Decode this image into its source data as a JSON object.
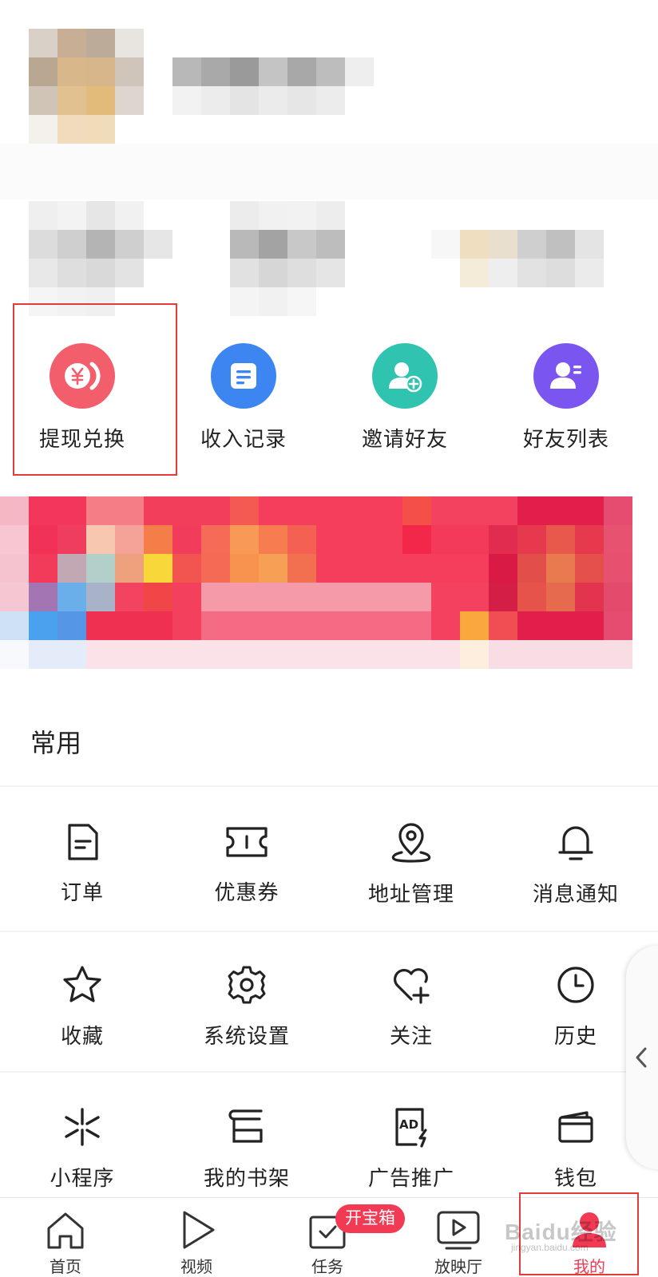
{
  "quick_actions": [
    {
      "label": "提现兑换",
      "icon": "yuan-coin-icon",
      "color": "#f25e6b"
    },
    {
      "label": "收入记录",
      "icon": "document-list-icon",
      "color": "#3d86f2"
    },
    {
      "label": "邀请好友",
      "icon": "add-user-icon",
      "color": "#2fc3b0"
    },
    {
      "label": "好友列表",
      "icon": "user-list-icon",
      "color": "#7a55f0"
    }
  ],
  "common": {
    "title": "常用",
    "items": [
      {
        "label": "订单",
        "icon": "order-icon"
      },
      {
        "label": "优惠券",
        "icon": "coupon-icon"
      },
      {
        "label": "地址管理",
        "icon": "location-pin-icon"
      },
      {
        "label": "消息通知",
        "icon": "bell-icon"
      },
      {
        "label": "收藏",
        "icon": "star-icon"
      },
      {
        "label": "系统设置",
        "icon": "gear-icon"
      },
      {
        "label": "关注",
        "icon": "heart-plus-icon"
      },
      {
        "label": "历史",
        "icon": "clock-icon"
      },
      {
        "label": "小程序",
        "icon": "mini-program-icon"
      },
      {
        "label": "我的书架",
        "icon": "bookshelf-icon"
      },
      {
        "label": "广告推广",
        "icon": "ad-icon"
      },
      {
        "label": "钱包",
        "icon": "wallet-icon"
      }
    ]
  },
  "bottom_nav": {
    "items": [
      {
        "label": "首页",
        "icon": "home-icon"
      },
      {
        "label": "视频",
        "icon": "play-icon"
      },
      {
        "label": "任务",
        "icon": "task-icon"
      },
      {
        "label": "放映厅",
        "icon": "screen-play-icon"
      },
      {
        "label": "我的",
        "icon": "profile-icon"
      }
    ],
    "badge": "开宝箱",
    "active_index": 4,
    "accent": "#f23a55"
  },
  "watermark": {
    "text": "Baidu经验",
    "sub": "jingyan.baidu.com"
  },
  "highlight_color": "#e33a3a"
}
